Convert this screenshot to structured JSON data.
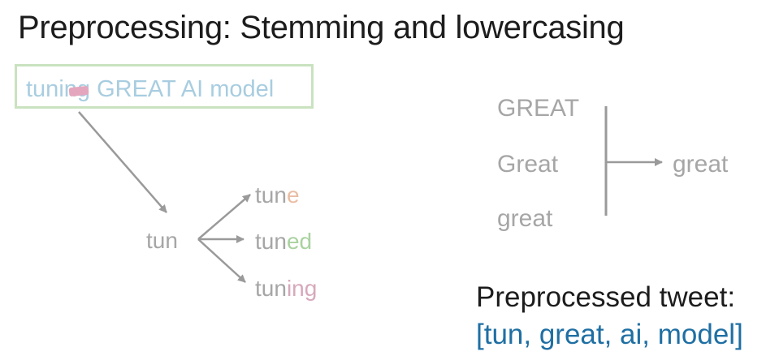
{
  "title": "Preprocessing: Stemming and lowercasing",
  "tweet": "tuning GREAT AI model",
  "stemming": {
    "root": "tun",
    "variants": [
      {
        "stem": "tun",
        "suffix": "e",
        "color": "#e9bda4"
      },
      {
        "stem": "tun",
        "suffix": "ed",
        "color": "#a9d2a0"
      },
      {
        "stem": "tun",
        "suffix": "ing",
        "color": "#d7a8bb"
      }
    ]
  },
  "lowercasing": {
    "inputs": [
      "GREAT",
      "Great",
      "great"
    ],
    "output": "great"
  },
  "preprocessed": {
    "label": "Preprocessed tweet:",
    "value": "[tun, great, ai, model]"
  },
  "colors": {
    "title": "#1c1c1c",
    "tweet_box_border": "#c9e2bf",
    "tweet_text": "#a8cde0",
    "muted_text": "#a6a6a6",
    "arrow": "#9a9a9a",
    "preprocessed_value": "#1f6fa3"
  }
}
